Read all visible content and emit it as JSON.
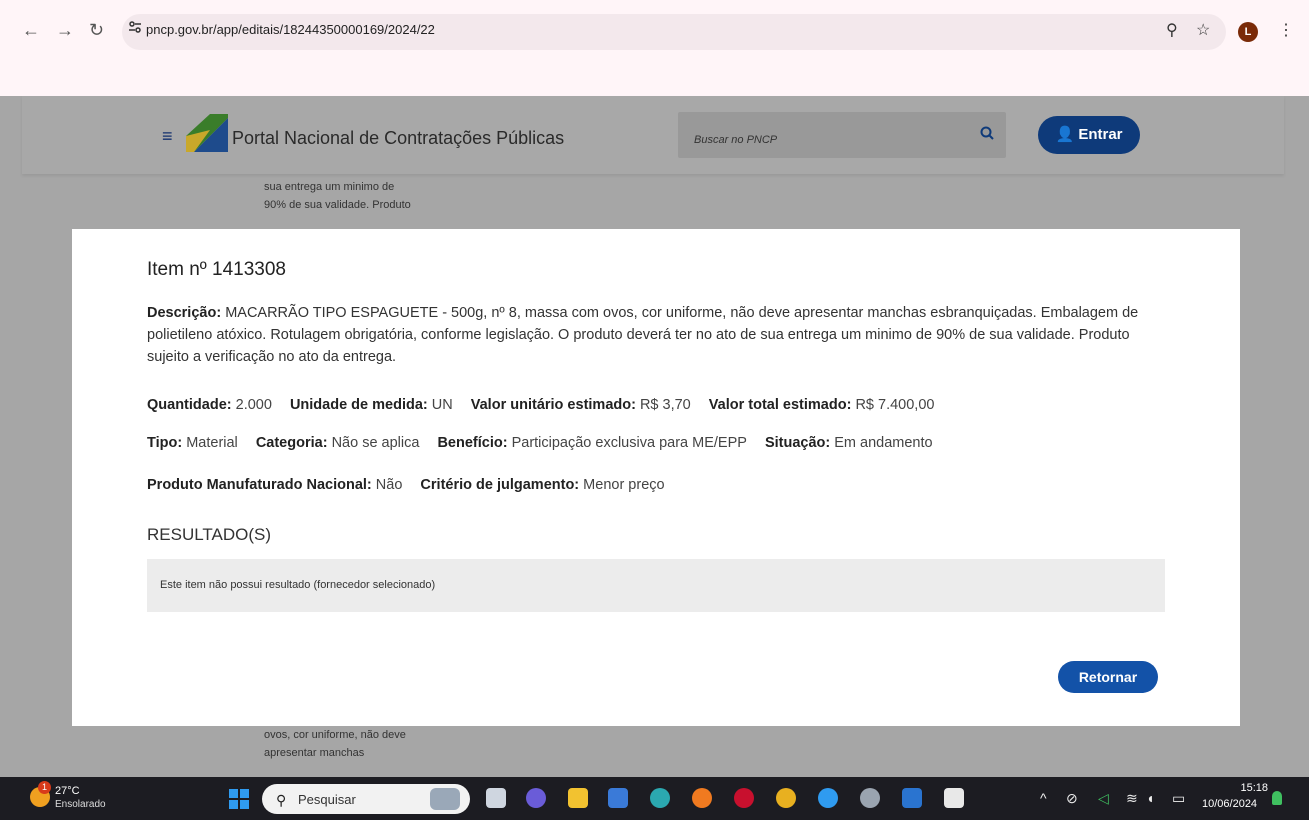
{
  "browser": {
    "url": "pncp.gov.br/app/editais/18244350000169/2024/22",
    "profile_initial": "L"
  },
  "site": {
    "title": "Portal Nacional de Contratações Públicas",
    "search_placeholder": "Buscar no PNCP",
    "login_label": "Entrar",
    "background_text_top": [
      "sua entrega um minimo de",
      "90% de sua validade. Produto"
    ],
    "background_text_bottom": [
      "ovos, cor uniforme, não deve",
      "apresentar manchas"
    ]
  },
  "modal": {
    "title": "Item nº 1413308",
    "description_label": "Descrição:",
    "description_value": "MACARRÃO TIPO ESPAGUETE - 500g, nº 8, massa com ovos, cor uniforme, não deve apresentar manchas esbranquiçadas. Embalagem de polietileno atóxico. Rotulagem obrigatória, conforme legislação. O produto deverá ter no ato de sua entrega um minimo de 90% de sua validade. Produto sujeito a verificação no ato da entrega.",
    "row1": [
      {
        "label": "Quantidade:",
        "value": "2.000"
      },
      {
        "label": "Unidade de medida:",
        "value": "UN"
      },
      {
        "label": "Valor unitário estimado:",
        "value": "R$ 3,70"
      },
      {
        "label": "Valor total estimado:",
        "value": "R$ 7.400,00"
      }
    ],
    "row2": [
      {
        "label": "Tipo:",
        "value": "Material"
      },
      {
        "label": "Categoria:",
        "value": "Não se aplica"
      },
      {
        "label": "Benefício:",
        "value": "Participação exclusiva para ME/EPP"
      },
      {
        "label": "Situação:",
        "value": "Em andamento"
      }
    ],
    "row3": [
      {
        "label": "Produto Manufaturado Nacional:",
        "value": "Não"
      },
      {
        "label": "Critério de julgamento:",
        "value": "Menor preço"
      }
    ],
    "results_title": "RESULTADO(S)",
    "results_empty": "Este item não possui resultado (fornecedor selecionado)",
    "return_label": "Retornar"
  },
  "taskbar": {
    "weather_badge": "1",
    "weather_temp": "27°C",
    "weather_condition": "Ensolarado",
    "search_label": "Pesquisar",
    "time": "15:18",
    "date": "10/06/2024"
  },
  "colors": {
    "primary_button": "#1352a8",
    "login_button": "#0e3a7a",
    "result_box": "#ececec"
  }
}
